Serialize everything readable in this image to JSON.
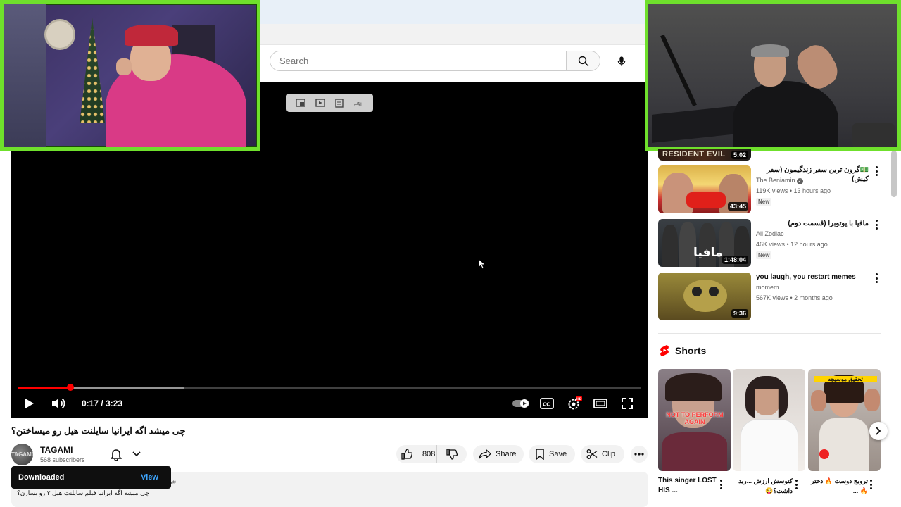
{
  "search": {
    "placeholder": "Search"
  },
  "player": {
    "time_display": "0:17 / 3:23",
    "played_fraction": 0.084,
    "buffered_fraction": 0.265
  },
  "video": {
    "title": "چی میشد اگه ایرانیا سایلنت هیل رو میساختن؟",
    "channel_name": "TAGAMI",
    "channel_avatar_text": "TAGAMI",
    "subscribers": "568 subscribers",
    "likes": "808",
    "share_label": "Share",
    "save_label": "Save",
    "clip_label": "Clip",
    "description_hashtag": "#طنز",
    "description_line": "چی میشه اگه ایرانیا فیلم سایلنت هیل ۲ رو بسازن؟"
  },
  "toast": {
    "text": "Downloaded",
    "action": "View"
  },
  "sidebar": {
    "top_partial": {
      "thumb_text": "RESIDENT EVIL",
      "duration": "5:02"
    },
    "recommendations": [
      {
        "title": "💵گرون ترین سفر زندگیمون (سفر کیش)",
        "channel": "The Beniamin",
        "stats": "119K views • 13 hours ago",
        "badge": "New",
        "duration": "43:45"
      },
      {
        "title": "مافیا با یوتوبرا (قسمت دوم)",
        "channel": "Ali Zodiac",
        "stats": "46K views • 12 hours ago",
        "badge": "New",
        "duration": "1:48:04"
      },
      {
        "title": "you laugh, you restart memes",
        "channel": "momem",
        "stats": "567K views • 2 months ago",
        "badge": "",
        "duration": "9:36"
      }
    ],
    "shorts_label": "Shorts",
    "shorts": [
      {
        "title": "This singer LOST HIS ...",
        "overlay": "NOT TO PERFORM AGAIN"
      },
      {
        "title": "کتوسش ارزش ...رید داشت؟😜",
        "overlay": ""
      },
      {
        "title": "ترویج دوست 🔥 دختر🔥 ...",
        "overlay": "تحقیق موسیچه"
      }
    ]
  },
  "colors": {
    "accent_red": "#ff0000",
    "cam_border": "#6fe02c",
    "link_blue": "#3ea6ff"
  },
  "icons": [
    "search-icon",
    "mic-icon",
    "play-icon",
    "volume-icon",
    "autoplay-toggle",
    "captions-icon",
    "settings-icon",
    "theater-icon",
    "fullscreen-icon",
    "like-icon",
    "dislike-icon",
    "share-icon",
    "save-icon",
    "clip-icon",
    "bell-icon",
    "chevron-down-icon",
    "kebab-icon",
    "shorts-icon",
    "chevron-right-icon",
    "verified-icon"
  ]
}
